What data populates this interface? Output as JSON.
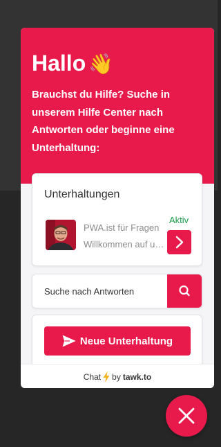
{
  "colors": {
    "accent": "#e8194b",
    "status_active": "#1d9a4a",
    "backdrop": "#262626"
  },
  "hero": {
    "title": "Hallo",
    "title_icon": "waving-hand-icon",
    "subtitle": "Brauchst du Hilfe? Suche in unserem Hilfe Center nach Antworten oder beginne eine Unterhaltung:"
  },
  "conversations": {
    "title": "Unterhaltungen",
    "items": [
      {
        "name": "PWA.ist für Fragen",
        "preview": "Willkommen auf unserer Seite",
        "status": "Aktiv",
        "avatar_icon": "agent-avatar",
        "open_icon": "chevron-right-icon"
      }
    ]
  },
  "search": {
    "placeholder": "Suche nach Antworten",
    "icon": "search-icon"
  },
  "new_conversation": {
    "label": "Neue Unterhaltung",
    "icon": "send-icon"
  },
  "footer": {
    "prefix": "Chat",
    "by": "by",
    "brand": "tawk.to",
    "icon": "lightning-icon"
  },
  "close_button": {
    "icon": "close-icon"
  }
}
